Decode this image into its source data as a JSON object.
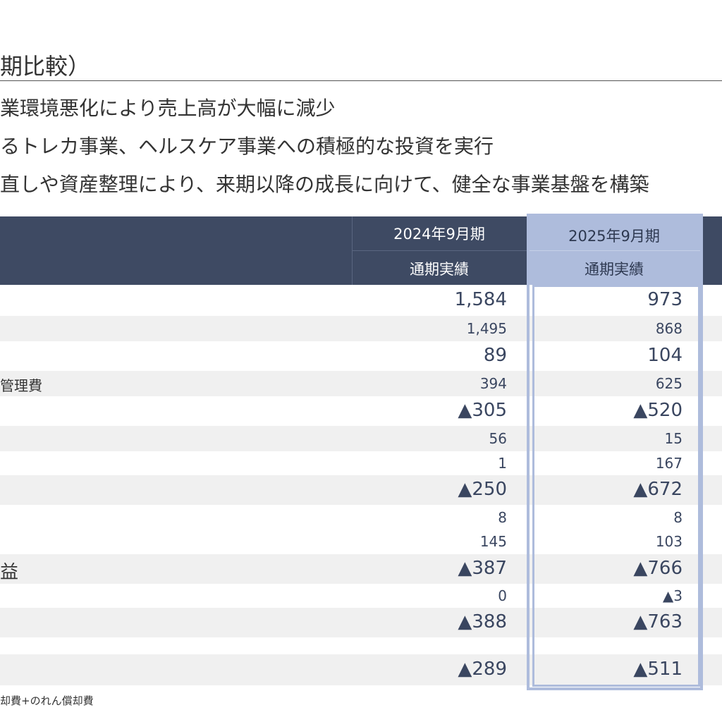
{
  "title": "期比較）",
  "bullets": [
    "業環境悪化により売上高が大幅に減少",
    "るトレカ事業、ヘルスケア事業への積極的な投資を実行",
    "直しや資産整理により、来期以降の成長に向けて、健全な事業基盤を構築"
  ],
  "table": {
    "headers": {
      "period_2024": "2024年9月期",
      "period_2025": "2025年9月期",
      "sub_2024": "通期実績",
      "sub_2025": "通期実績"
    },
    "rows": [
      {
        "label": "",
        "v2024": "1,584",
        "v2025": "973"
      },
      {
        "label": "",
        "v2024": "1,495",
        "v2025": "868"
      },
      {
        "label": "",
        "v2024": "89",
        "v2025": "104"
      },
      {
        "label": "管理費",
        "v2024": "394",
        "v2025": "625"
      },
      {
        "label": "",
        "v2024": "▲305",
        "v2025": "▲520"
      },
      {
        "label": "",
        "v2024": "56",
        "v2025": "15"
      },
      {
        "label": "",
        "v2024": "1",
        "v2025": "167"
      },
      {
        "label": "",
        "v2024": "▲250",
        "v2025": "▲672"
      },
      {
        "label": "",
        "v2024": "8",
        "v2025": "8"
      },
      {
        "label": "",
        "v2024": "145",
        "v2025": "103"
      },
      {
        "label": "益",
        "v2024": "▲387",
        "v2025": "▲766"
      },
      {
        "label": "",
        "v2024": "0",
        "v2025": "▲3"
      },
      {
        "label": "",
        "v2024": "▲388",
        "v2025": "▲763"
      },
      {
        "label": "",
        "v2024": "",
        "v2025": ""
      },
      {
        "label": "",
        "v2024": "▲289",
        "v2025": "▲511"
      }
    ]
  },
  "footnote": "却費+のれん償却費",
  "colors": {
    "header_bg": "#3e4a63",
    "highlight": "#aebcdc",
    "row_shade": "#f0f0f0",
    "value_text": "#3a4660"
  }
}
